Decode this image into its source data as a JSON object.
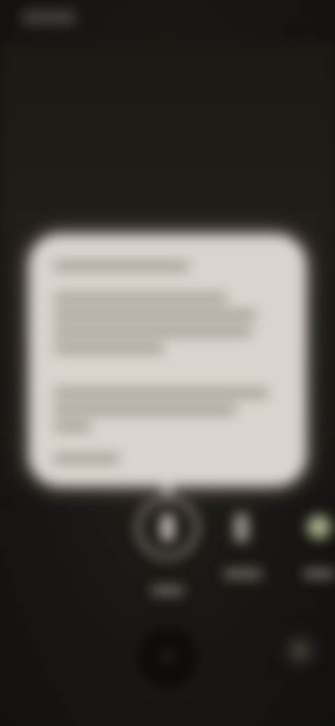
{
  "colors": {
    "background": "#14120f",
    "card": "#d9d5ce",
    "card_text_placeholder": "#a39d94",
    "mode_ring": "#cfcac2",
    "mode_accent": "#a7b087",
    "shutter": "#0d0c0b"
  },
  "icons": {
    "mode_primary": "phone-portrait-icon",
    "mode_secondary": "phone-portrait-icon",
    "mode_tertiary": "circle-icon",
    "shutter": "shutter-icon",
    "side_action": "square-icon"
  }
}
